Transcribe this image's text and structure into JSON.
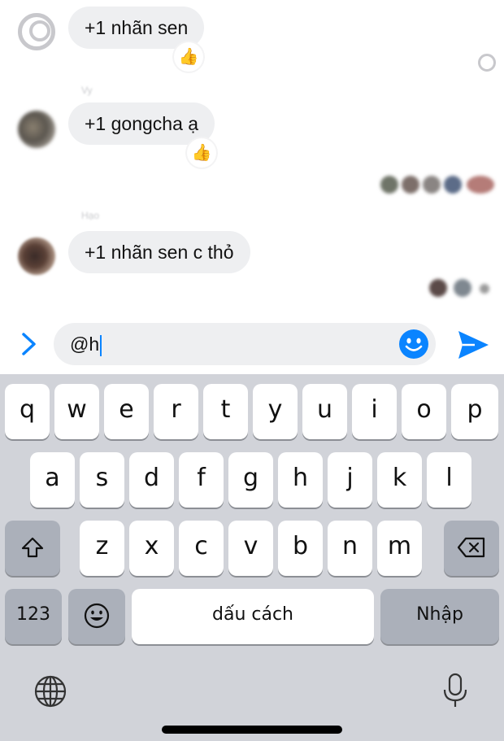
{
  "chat": {
    "messages": [
      {
        "sender": "",
        "text": "+1 nhãn sen",
        "reaction": "👍"
      },
      {
        "sender": "Vy",
        "text": "+1 gongcha ạ",
        "reaction": "👍"
      },
      {
        "sender": "Hạo",
        "text": "+1 nhãn sen c thỏ",
        "reaction": ""
      }
    ]
  },
  "composer": {
    "input_value": "@h",
    "expand_icon": "chevron-right-icon",
    "emoji_icon": "smiley-icon",
    "send_icon": "send-icon",
    "accent_color": "#0a84ff"
  },
  "keyboard": {
    "row1": [
      "q",
      "w",
      "e",
      "r",
      "t",
      "y",
      "u",
      "i",
      "o",
      "p"
    ],
    "row2": [
      "a",
      "s",
      "d",
      "f",
      "g",
      "h",
      "j",
      "k",
      "l"
    ],
    "row3": [
      "z",
      "x",
      "c",
      "v",
      "b",
      "n",
      "m"
    ],
    "numbers_label": "123",
    "space_label": "dấu cách",
    "return_label": "Nhập",
    "shift_icon": "shift-icon",
    "delete_icon": "backspace-icon",
    "emoji_icon": "emoji-icon",
    "globe_icon": "globe-icon",
    "mic_icon": "microphone-icon",
    "background_color": "#d1d3d9"
  }
}
